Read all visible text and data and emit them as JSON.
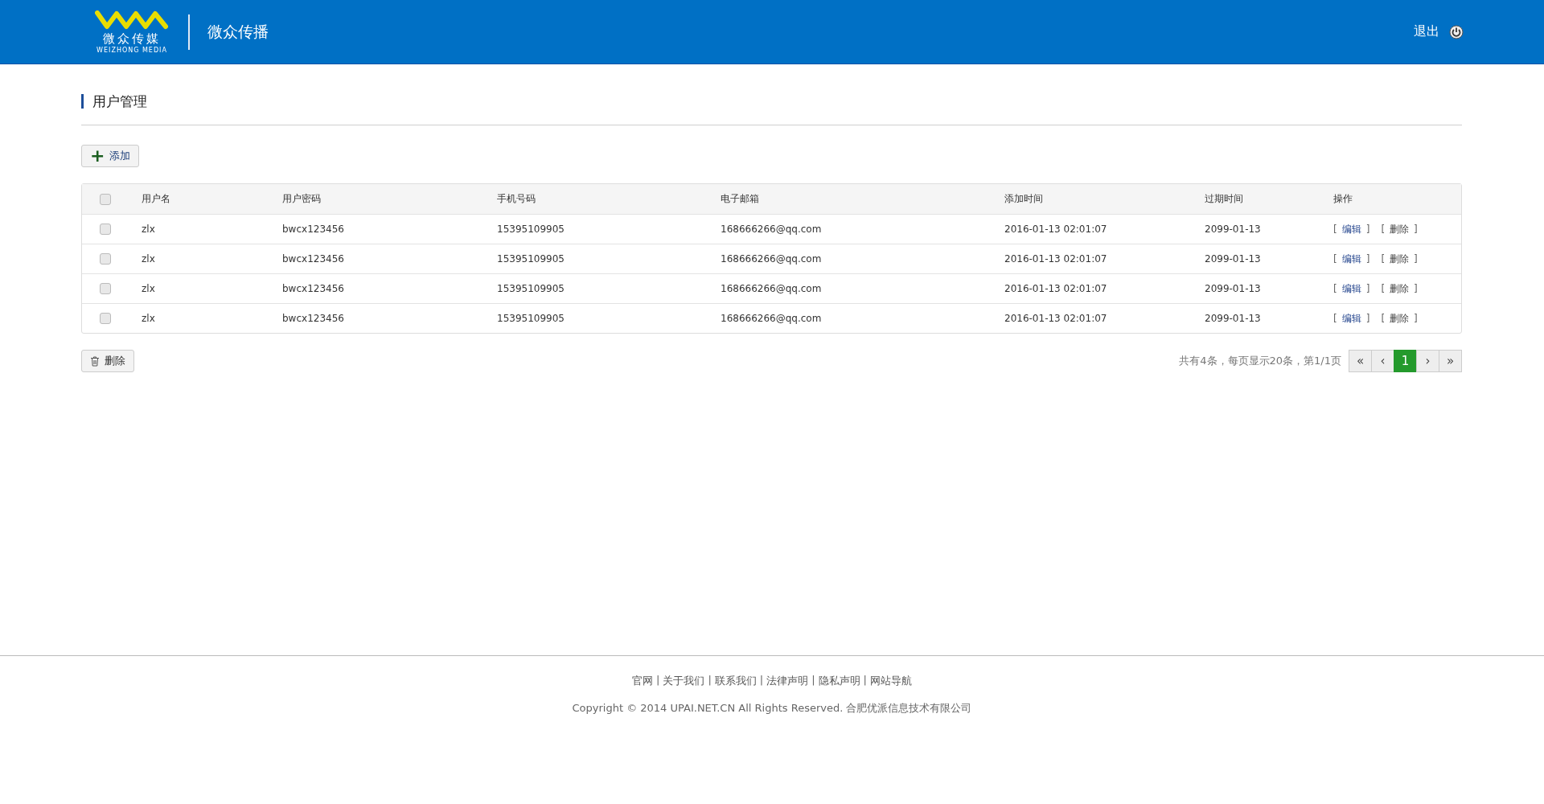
{
  "header": {
    "logo_text": "微众传媒",
    "logo_subtext": "WEIZHONG MEDIA",
    "title": "微众传播",
    "logout": "退出"
  },
  "page_title": "用户管理",
  "add_button": {
    "icon": "+",
    "label": "添加"
  },
  "table": {
    "select_all": {
      "checked": false
    },
    "columns": [
      "用户名",
      "用户密码",
      "手机号码",
      "电子邮箱",
      "添加时间",
      "过期时间",
      "操作"
    ],
    "rows": [
      {
        "checked": false,
        "cells": [
          "zlx",
          "bwcx123456",
          "15395109905",
          "168666266@qq.com",
          "2016-01-13 02:01:07",
          "2099-01-13"
        ],
        "actions": [
          {
            "kind": "edit",
            "open": "[",
            "label": "编辑",
            "close": "]"
          },
          {
            "kind": "delete",
            "open": "[",
            "label": "删除",
            "close": "]"
          }
        ]
      },
      {
        "checked": false,
        "cells": [
          "zlx",
          "bwcx123456",
          "15395109905",
          "168666266@qq.com",
          "2016-01-13 02:01:07",
          "2099-01-13"
        ],
        "actions": [
          {
            "kind": "edit",
            "open": "[",
            "label": "编辑",
            "close": "]"
          },
          {
            "kind": "delete",
            "open": "[",
            "label": "删除",
            "close": "]"
          }
        ]
      },
      {
        "checked": false,
        "cells": [
          "zlx",
          "bwcx123456",
          "15395109905",
          "168666266@qq.com",
          "2016-01-13 02:01:07",
          "2099-01-13"
        ],
        "actions": [
          {
            "kind": "edit",
            "open": "[",
            "label": "编辑",
            "close": "]"
          },
          {
            "kind": "delete",
            "open": "[",
            "label": "删除",
            "close": "]"
          }
        ]
      },
      {
        "checked": false,
        "cells": [
          "zlx",
          "bwcx123456",
          "15395109905",
          "168666266@qq.com",
          "2016-01-13 02:01:07",
          "2099-01-13"
        ],
        "actions": [
          {
            "kind": "edit",
            "open": "[",
            "label": "编辑",
            "close": "]"
          },
          {
            "kind": "delete",
            "open": "[",
            "label": "删除",
            "close": "]"
          }
        ]
      }
    ]
  },
  "delete_button": {
    "label": "删除"
  },
  "pagination": {
    "summary": "共有4条，每页显示20条，第1/1页",
    "buttons": [
      {
        "label": "«",
        "selected": false
      },
      {
        "label": "‹",
        "selected": false
      },
      {
        "label": "1",
        "selected": true
      },
      {
        "label": "›",
        "selected": false
      },
      {
        "label": "»",
        "selected": false
      }
    ]
  },
  "footer": {
    "links": [
      "官网",
      "关于我们",
      "联系我们",
      "法律声明",
      "隐私声明",
      "网站导航"
    ],
    "separator": "|",
    "copyright": "Copyright © 2014 UPAI.NET.CN All Rights Reserved. 合肥优派信息技术有限公司"
  }
}
